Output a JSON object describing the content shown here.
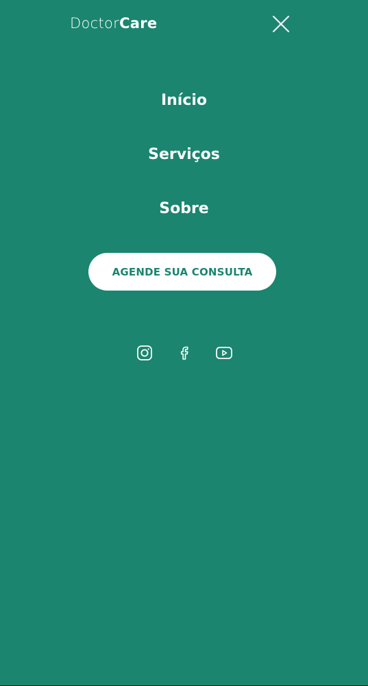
{
  "brand": {
    "name_light": "Doctor",
    "name_bold": "Care"
  },
  "header": {
    "close_icon": "close-icon"
  },
  "nav": {
    "items": [
      {
        "label": "Início"
      },
      {
        "label": "Serviços"
      },
      {
        "label": "Sobre"
      }
    ]
  },
  "cta": {
    "label": "AGENDE SUA CONSULTA"
  },
  "social": {
    "icons": [
      "instagram-icon",
      "facebook-icon",
      "youtube-icon"
    ]
  },
  "colors": {
    "background": "#1b856f",
    "foreground": "#ffffff",
    "cta_text": "#1b856f"
  }
}
